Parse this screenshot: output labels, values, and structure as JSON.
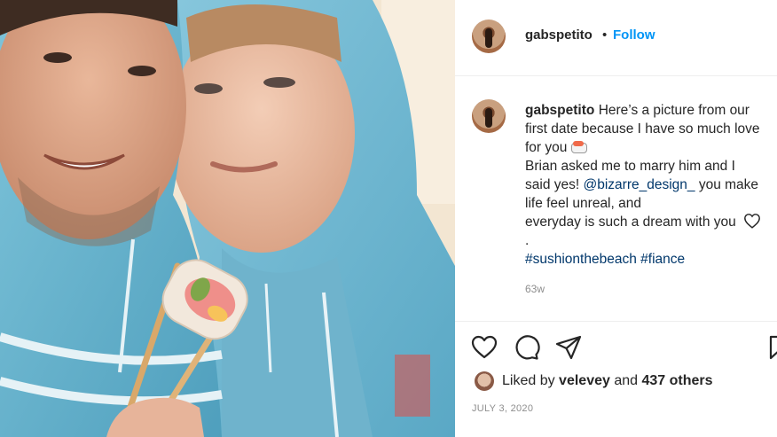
{
  "post": {
    "username": "gabspetito",
    "separator": "•",
    "follow_label": "Follow"
  },
  "caption": {
    "username": "gabspetito",
    "line1": "Here’s a picture from our",
    "line2": "first date because I have so much love",
    "line3": "for you",
    "line3_emoji": "sushi-emoji",
    "line4": "Brian asked me to marry him and I",
    "line5_start": "said yes! ",
    "mention": "@bizarre_design_",
    "line5_end": " you make",
    "line6": "life feel unreal, and",
    "line7": "everyday is such a dream with you",
    "line7_icon": "heart-icon",
    "line8": ".",
    "hashtag1": "#sushionthebeach",
    "hashtag2": "#fiance"
  },
  "time_ago": "63w",
  "actions": {
    "like_icon": "heart-icon",
    "comment_icon": "comment-icon",
    "share_icon": "send-icon",
    "save_icon": "bookmark-icon"
  },
  "likes": {
    "prefix": "Liked by",
    "user": "velevey",
    "and": "and",
    "others": "437 others"
  },
  "date": "JULY 3, 2020",
  "colors": {
    "link_blue": "#0095f6",
    "hashtag": "#00376b",
    "text": "#262626",
    "muted": "#8e8e8e",
    "hoodie": "#6cb6cf"
  }
}
